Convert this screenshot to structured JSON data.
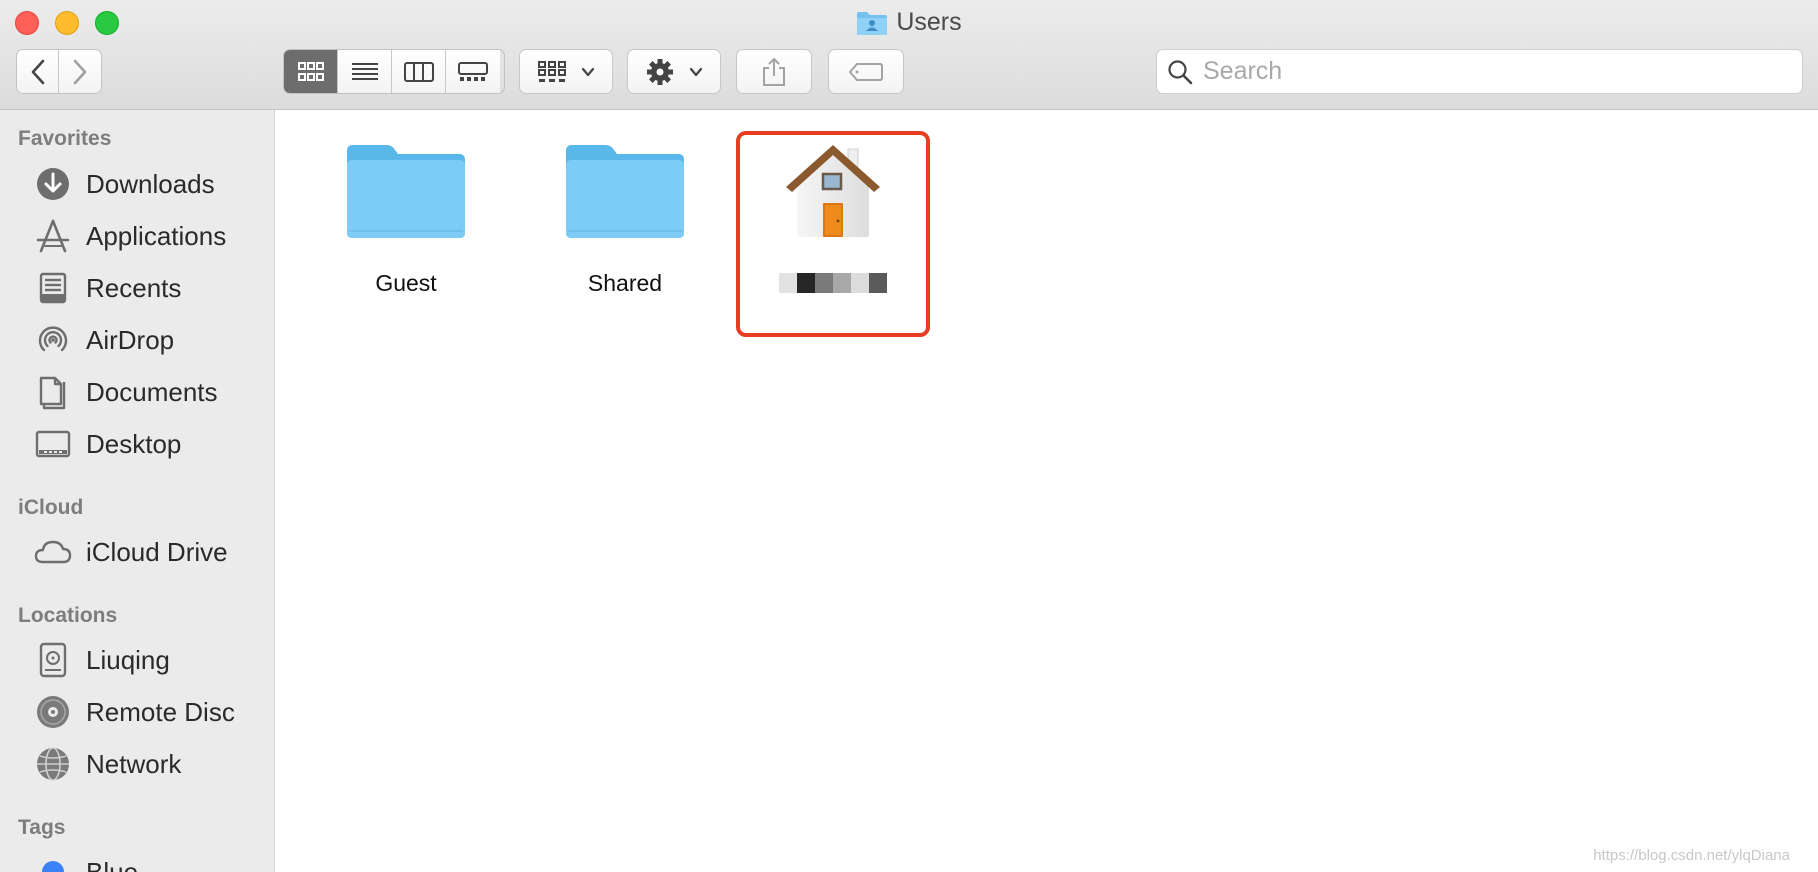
{
  "window": {
    "title": "Users",
    "traffic_lights": {
      "close": "#fe5f57",
      "minimize": "#febc2e",
      "zoom": "#28c840"
    }
  },
  "toolbar": {
    "back_icon": "chevron-left-icon",
    "forward_icon": "chevron-right-icon",
    "view_modes": [
      "icon-view",
      "list-view",
      "column-view",
      "gallery-view"
    ],
    "active_view": "icon-view",
    "group_icon": "group-icon",
    "action_icon": "gear-icon",
    "share_icon": "share-icon",
    "tag_icon": "tag-icon",
    "search_placeholder": "Search"
  },
  "sidebar": {
    "sections": [
      {
        "header": "Favorites",
        "items": [
          {
            "label": "Downloads",
            "icon": "download-icon"
          },
          {
            "label": "Applications",
            "icon": "applications-icon"
          },
          {
            "label": "Recents",
            "icon": "recents-icon"
          },
          {
            "label": "AirDrop",
            "icon": "airdrop-icon"
          },
          {
            "label": "Documents",
            "icon": "document-icon"
          },
          {
            "label": "Desktop",
            "icon": "desktop-icon"
          }
        ]
      },
      {
        "header": "iCloud",
        "items": [
          {
            "label": "iCloud Drive",
            "icon": "cloud-icon"
          }
        ]
      },
      {
        "header": "Locations",
        "items": [
          {
            "label": "Liuqing",
            "icon": "hard-drive-icon"
          },
          {
            "label": "Remote Disc",
            "icon": "disc-icon"
          },
          {
            "label": "Network",
            "icon": "network-icon"
          }
        ]
      },
      {
        "header": "Tags",
        "items": [
          {
            "label": "Blue",
            "icon": "tag-color-icon",
            "color": "#3b82f6"
          }
        ]
      }
    ]
  },
  "content": {
    "items": [
      {
        "label": "Guest",
        "icon": "folder-icon"
      },
      {
        "label": "Shared",
        "icon": "folder-icon"
      },
      {
        "label": "",
        "icon": "home-icon",
        "highlighted": true,
        "label_obscured": true
      }
    ],
    "highlight_color": "#ea3c23"
  },
  "watermark": "https://blog.csdn.net/ylqDiana"
}
